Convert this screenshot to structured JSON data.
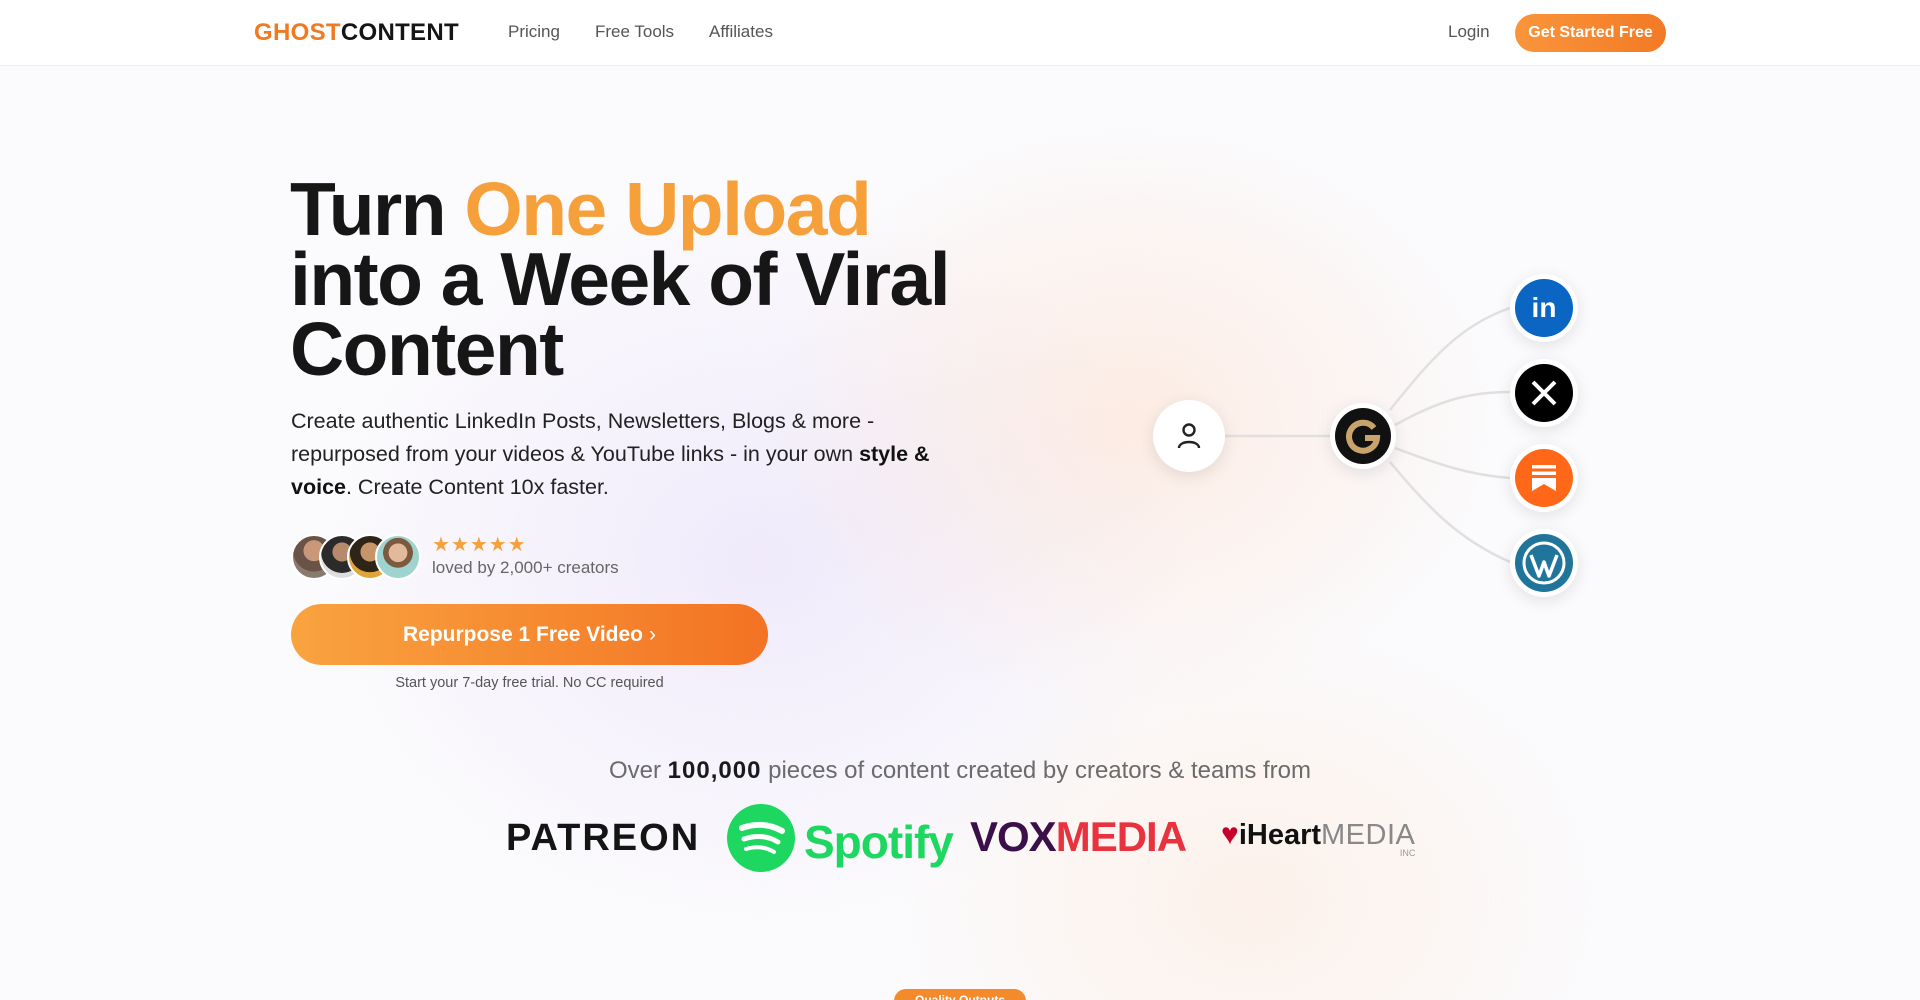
{
  "nav": {
    "logo_part1": "GHOST",
    "logo_part2": "CONTENT",
    "links": [
      "Pricing",
      "Free Tools",
      "Affiliates"
    ],
    "login": "Login",
    "cta": "Get Started Free"
  },
  "hero": {
    "headline_start": "Turn ",
    "headline_accent": "One Upload",
    "headline_rest": "into a Week of Viral Content",
    "sub_part1": "Create authentic LinkedIn Posts, Newsletters, Blogs & more - repurposed from your videos & YouTube links - in your own ",
    "sub_bold": "style & voice",
    "sub_part2": ". Create Content 10x faster.",
    "stars": "★★★★★",
    "loved": "loved by 2,000+ creators",
    "cta": "Repurpose 1 Free Video",
    "cta_chevron": "›",
    "trial_note": "Start your 7-day free trial. No CC required"
  },
  "diagram": {
    "icons": [
      "user-icon",
      "ghostcontent-g-icon",
      "linkedin-icon",
      "x-icon",
      "substack-icon",
      "wordpress-icon"
    ],
    "colors": {
      "linkedin": "#0a66c2",
      "x": "#000000",
      "substack": "#ff6719",
      "wordpress": "#21759b",
      "g_gold": "#c8a46a"
    }
  },
  "proof": {
    "prefix": "Over ",
    "count": "100,000",
    "suffix": " pieces of content created by creators & teams from",
    "brands": {
      "patreon": "PATREON",
      "spotify": "Spotify",
      "vox_a": "VOX",
      "vox_b": "MEDIA",
      "iheart_a": "iHeart",
      "iheart_b": "MEDIA",
      "iheart_inc": "INC"
    }
  },
  "badge": "Quality Outputs"
}
